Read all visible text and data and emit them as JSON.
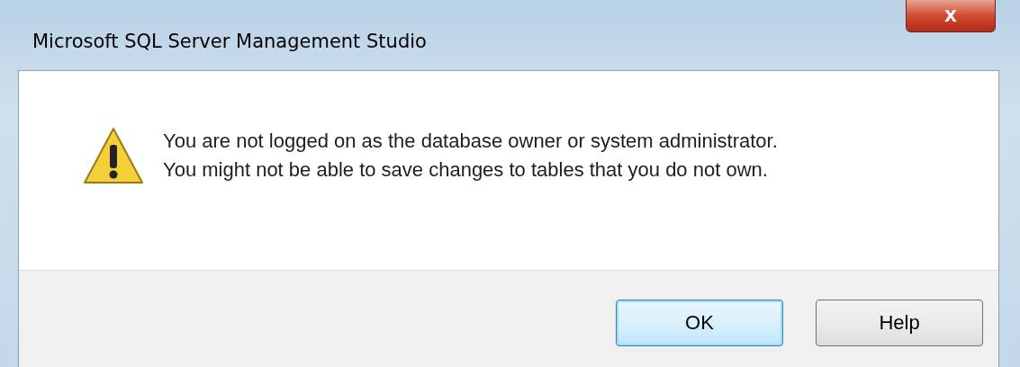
{
  "window": {
    "title": "Microsoft SQL Server Management Studio",
    "close_button": "X"
  },
  "message": {
    "kind": "warning",
    "lines": [
      "You are not logged on as the database owner or system administrator.",
      "You might not be able to save changes to tables that you do not own."
    ]
  },
  "buttons": [
    {
      "label": "OK",
      "default": true
    },
    {
      "label": "Help",
      "default": false
    }
  ]
}
